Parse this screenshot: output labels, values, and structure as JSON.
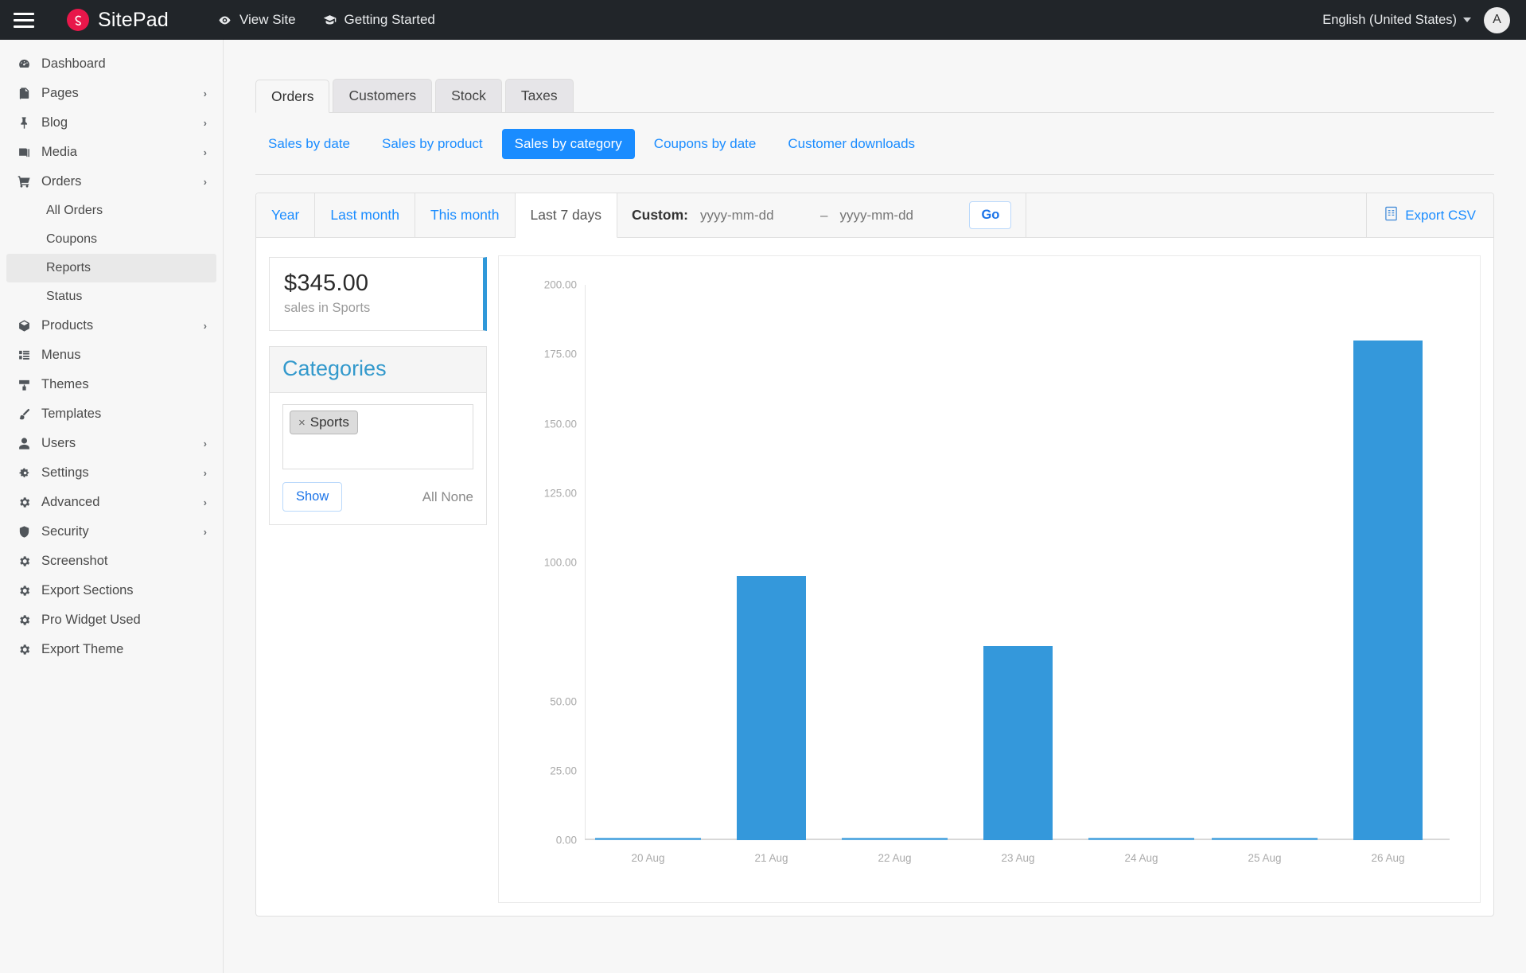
{
  "topbar": {
    "menu_icon": "hamburger-icon",
    "brand": "SitePad",
    "brand_logo": "sitepad-logo-icon",
    "links": [
      {
        "label": "View Site",
        "icon": "eye-icon"
      },
      {
        "label": "Getting Started",
        "icon": "graduation-cap-icon"
      }
    ],
    "language": "English (United States)",
    "avatar_initial": "A"
  },
  "sidebar": {
    "items": [
      {
        "label": "Dashboard",
        "icon": "dashboard-icon",
        "arrow": ""
      },
      {
        "label": "Pages",
        "icon": "pages-icon",
        "arrow": "›"
      },
      {
        "label": "Blog",
        "icon": "pin-icon",
        "arrow": "›"
      },
      {
        "label": "Media",
        "icon": "media-icon",
        "arrow": "›"
      },
      {
        "label": "Orders",
        "icon": "cart-icon",
        "arrow": "›"
      }
    ],
    "orders_sub": [
      {
        "label": "All Orders",
        "active": false
      },
      {
        "label": "Coupons",
        "active": false
      },
      {
        "label": "Reports",
        "active": true
      },
      {
        "label": "Status",
        "active": false
      }
    ],
    "items2": [
      {
        "label": "Products",
        "icon": "box-icon",
        "arrow": "›"
      },
      {
        "label": "Menus",
        "icon": "menus-icon",
        "arrow": ""
      },
      {
        "label": "Themes",
        "icon": "themes-icon",
        "arrow": ""
      },
      {
        "label": "Templates",
        "icon": "brush-icon",
        "arrow": ""
      },
      {
        "label": "Users",
        "icon": "user-icon",
        "arrow": "›"
      },
      {
        "label": "Settings",
        "icon": "gears-icon",
        "arrow": "›"
      },
      {
        "label": "Advanced",
        "icon": "gear-icon",
        "arrow": "›"
      },
      {
        "label": "Security",
        "icon": "shield-icon",
        "arrow": "›"
      },
      {
        "label": "Screenshot",
        "icon": "gear-icon",
        "arrow": ""
      },
      {
        "label": "Export Sections",
        "icon": "gear-icon",
        "arrow": ""
      },
      {
        "label": "Pro Widget Used",
        "icon": "gear-icon",
        "arrow": ""
      },
      {
        "label": "Export Theme",
        "icon": "gear-icon",
        "arrow": ""
      }
    ]
  },
  "tabs": [
    {
      "label": "Orders",
      "active": true
    },
    {
      "label": "Customers",
      "active": false
    },
    {
      "label": "Stock",
      "active": false
    },
    {
      "label": "Taxes",
      "active": false
    }
  ],
  "pills": [
    {
      "label": "Sales by date",
      "active": false
    },
    {
      "label": "Sales by product",
      "active": false
    },
    {
      "label": "Sales by category",
      "active": true
    },
    {
      "label": "Coupons by date",
      "active": false
    },
    {
      "label": "Customer downloads",
      "active": false
    }
  ],
  "range": {
    "options": [
      {
        "label": "Year",
        "active": false
      },
      {
        "label": "Last month",
        "active": false
      },
      {
        "label": "This month",
        "active": false
      },
      {
        "label": "Last 7 days",
        "active": true
      }
    ],
    "custom_label": "Custom:",
    "from_placeholder": "yyyy-mm-dd",
    "from_value": "",
    "separator": "–",
    "to_placeholder": "yyyy-mm-dd",
    "to_value": "",
    "go_label": "Go",
    "export_label": "Export CSV",
    "export_icon": "csv-file-icon"
  },
  "summary": {
    "amount": "$345.00",
    "caption": "sales in Sports",
    "accent_color": "#2f98d9"
  },
  "categories_widget": {
    "title": "Categories",
    "chips": [
      {
        "label": "Sports",
        "remove": "×"
      }
    ],
    "show_label": "Show",
    "all_label": "All",
    "none_label": "None"
  },
  "chart_data": {
    "type": "bar",
    "title": "",
    "xlabel": "",
    "ylabel": "",
    "categories": [
      "20 Aug",
      "21 Aug",
      "22 Aug",
      "23 Aug",
      "24 Aug",
      "25 Aug",
      "26 Aug"
    ],
    "values": [
      0,
      95,
      0,
      70,
      0,
      0,
      180
    ],
    "ylim": [
      0,
      200
    ],
    "yticks": [
      200.0,
      175.0,
      150.0,
      125.0,
      100.0,
      75.0,
      50.0,
      25.0,
      0.0
    ],
    "ytick_labels": [
      "200.00",
      "175.00",
      "150.00",
      "125.00",
      "100.00",
      "",
      "50.00",
      "25.00",
      "0.00"
    ],
    "bar_color": "#3498db",
    "grid": false,
    "legend": "none"
  }
}
